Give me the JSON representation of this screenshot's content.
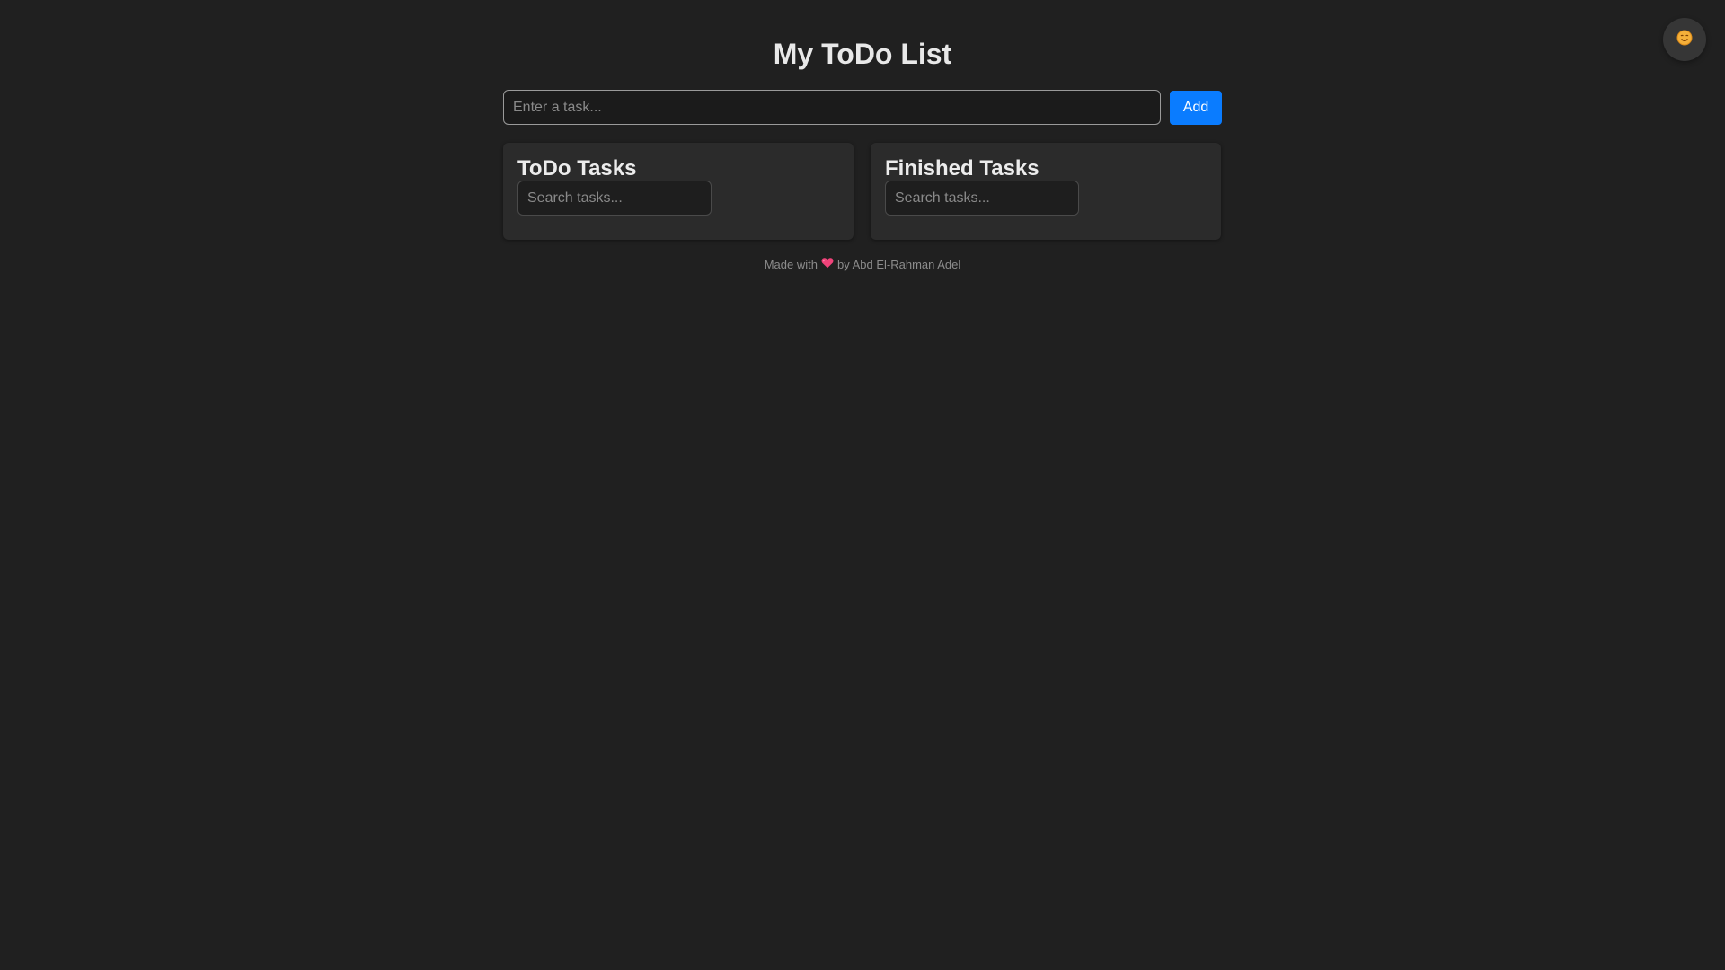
{
  "header": {
    "title": "My ToDo List"
  },
  "add_task": {
    "placeholder": "Enter a task...",
    "value": "",
    "button_label": "Add"
  },
  "todo_panel": {
    "title": "ToDo Tasks",
    "search_placeholder": "Search tasks...",
    "search_value": "",
    "items": []
  },
  "finished_panel": {
    "title": "Finished Tasks",
    "search_placeholder": "Search tasks...",
    "search_value": "",
    "items": []
  },
  "footer": {
    "prefix": "Made with",
    "heart_icon": "heart-icon",
    "suffix": "by Abd El-Rahman Adel"
  },
  "theme_toggle": {
    "icon": "sun-face-icon"
  },
  "colors": {
    "background": "#202020",
    "panel": "#2b2b2b",
    "accent": "#0a7cff",
    "heart": "#f0437a",
    "sun": "#f5b03a"
  }
}
